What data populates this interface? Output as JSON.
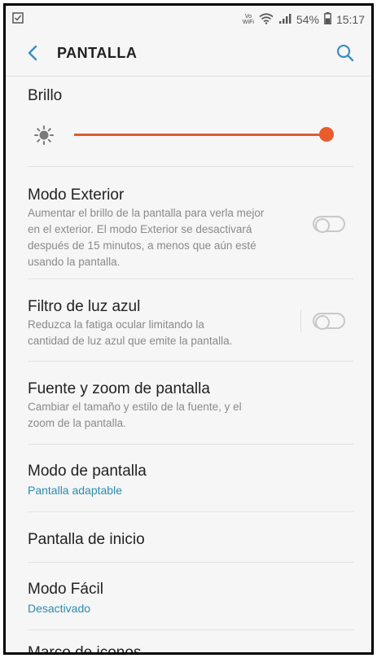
{
  "statusbar": {
    "battery_text": "54%",
    "time": "15:17",
    "volte_line1": "Vo",
    "volte_line2": "WiFi"
  },
  "header": {
    "title": "PANTALLA"
  },
  "brightness": {
    "label": "Brillo",
    "level_percent": 100,
    "accent": "#e85c2e"
  },
  "items": [
    {
      "title": "Modo Exterior",
      "desc": [
        "Aumentar el brillo de la pantalla para verla mejor",
        "en el exterior. El modo Exterior se desactivará",
        "después de 15 minutos, a menos que aún esté",
        "usando la pantalla."
      ],
      "toggle": false
    },
    {
      "title": "Filtro de luz azul",
      "desc": [
        "Reduzca la fatiga ocular limitando la",
        "cantidad de luz azul que emite la pantalla."
      ],
      "toggle": false
    },
    {
      "title": "Fuente y zoom de pantalla",
      "desc": [
        "Cambiar el tamaño y estilo de la fuente, y el",
        "zoom de la pantalla."
      ]
    },
    {
      "title": "Modo de pantalla",
      "sub": "Pantalla adaptable"
    },
    {
      "title": "Pantalla de inicio"
    },
    {
      "title": "Modo Fácil",
      "sub": "Desactivado"
    },
    {
      "title": "Marco de iconos"
    }
  ],
  "colors": {
    "link": "#2a8bb0",
    "accent": "#e85c2e"
  }
}
